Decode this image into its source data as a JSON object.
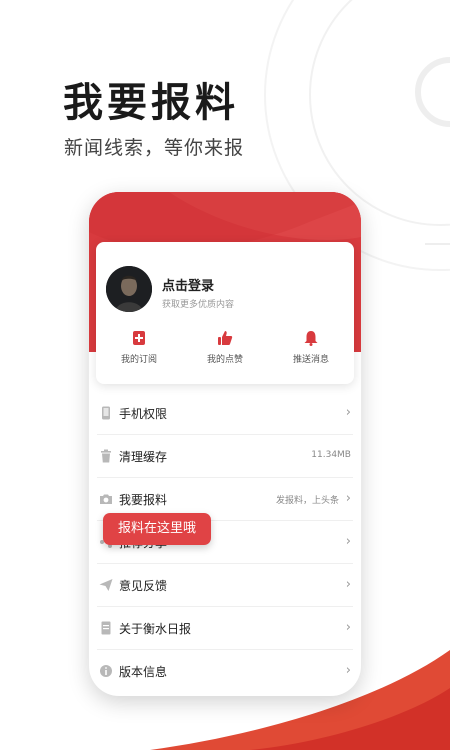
{
  "hero": {
    "title": "我要报料",
    "subtitle": "新闻线索，等你来报"
  },
  "profile": {
    "login_title": "点击登录",
    "login_subtitle": "获取更多优质内容"
  },
  "quick_actions": [
    {
      "label": "我的订阅",
      "icon": "subscription-icon"
    },
    {
      "label": "我的点赞",
      "icon": "thumbs-up-icon"
    },
    {
      "label": "推送消息",
      "icon": "bell-icon"
    }
  ],
  "menu": [
    {
      "label": "手机权限",
      "value": "",
      "icon": "phone-icon"
    },
    {
      "label": "清理缓存",
      "value": "11.34MB",
      "icon": "trash-icon"
    },
    {
      "label": "我要报料",
      "value": "发报料，上头条",
      "icon": "camera-icon"
    },
    {
      "label": "推荐分享",
      "value": "",
      "icon": "share-icon"
    },
    {
      "label": "意见反馈",
      "value": "",
      "icon": "paper-plane-icon"
    },
    {
      "label": "关于衡水日报",
      "value": "",
      "icon": "document-icon"
    },
    {
      "label": "版本信息",
      "value": "",
      "icon": "info-icon"
    }
  ],
  "tooltip": "报料在这里哦",
  "colors": {
    "brand_red": "#d83a3e",
    "tooltip_red": "#e04345",
    "icon_gray": "#b8b8b8"
  }
}
